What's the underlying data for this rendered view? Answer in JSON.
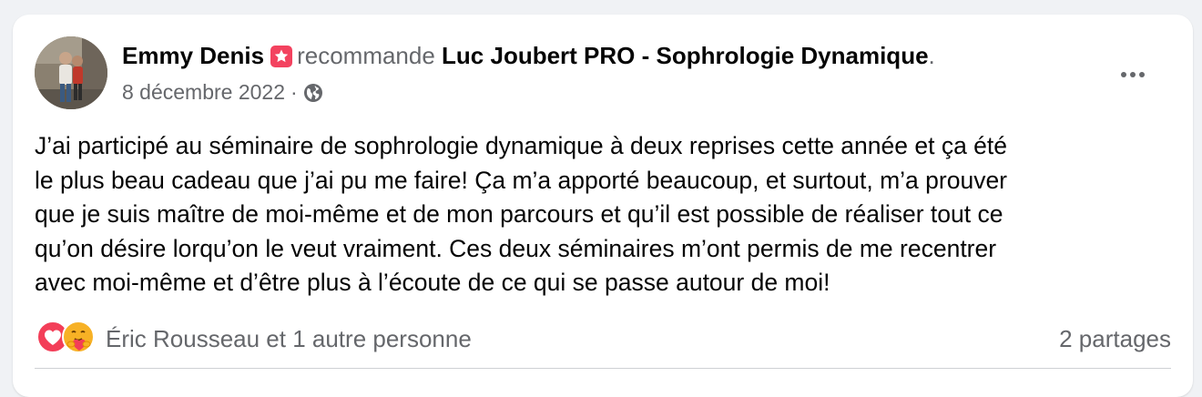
{
  "post": {
    "author": "Emmy Denis",
    "action": "recommande",
    "page_name": "Luc Joubert PRO - Sophrologie Dynamique",
    "punct": ".",
    "date": "8 décembre 2022",
    "separator": "·",
    "privacy_icon": "globe-icon",
    "body_lines": [
      "J’ai participé au séminaire de sophrologie dynamique à deux reprises cette année et ça été",
      "le plus beau cadeau que j’ai pu me faire! Ça m’a apporté beaucoup, et surtout, m’a prouver",
      "que je suis maître de moi-même et de mon parcours et qu’il est possible de réaliser tout ce",
      "qu’on désire lorqu’on le veut vraiment. Ces deux séminaires m’ont permis de me recentrer",
      "avec moi-même et d’être plus à l’écoute de ce qui se passe autour de moi!"
    ]
  },
  "footer": {
    "reaction_icons": [
      "love-reaction-icon",
      "care-reaction-icon"
    ],
    "reactors": "Éric Rousseau et 1 autre personne",
    "shares": "2 partages"
  },
  "colors": {
    "background": "#f0f2f5",
    "card": "#ffffff",
    "text_primary": "#050505",
    "text_secondary": "#65676b",
    "recommend_badge": "#f3425f",
    "love_reaction": "#f33e58",
    "care_reaction": "#f7b125"
  }
}
